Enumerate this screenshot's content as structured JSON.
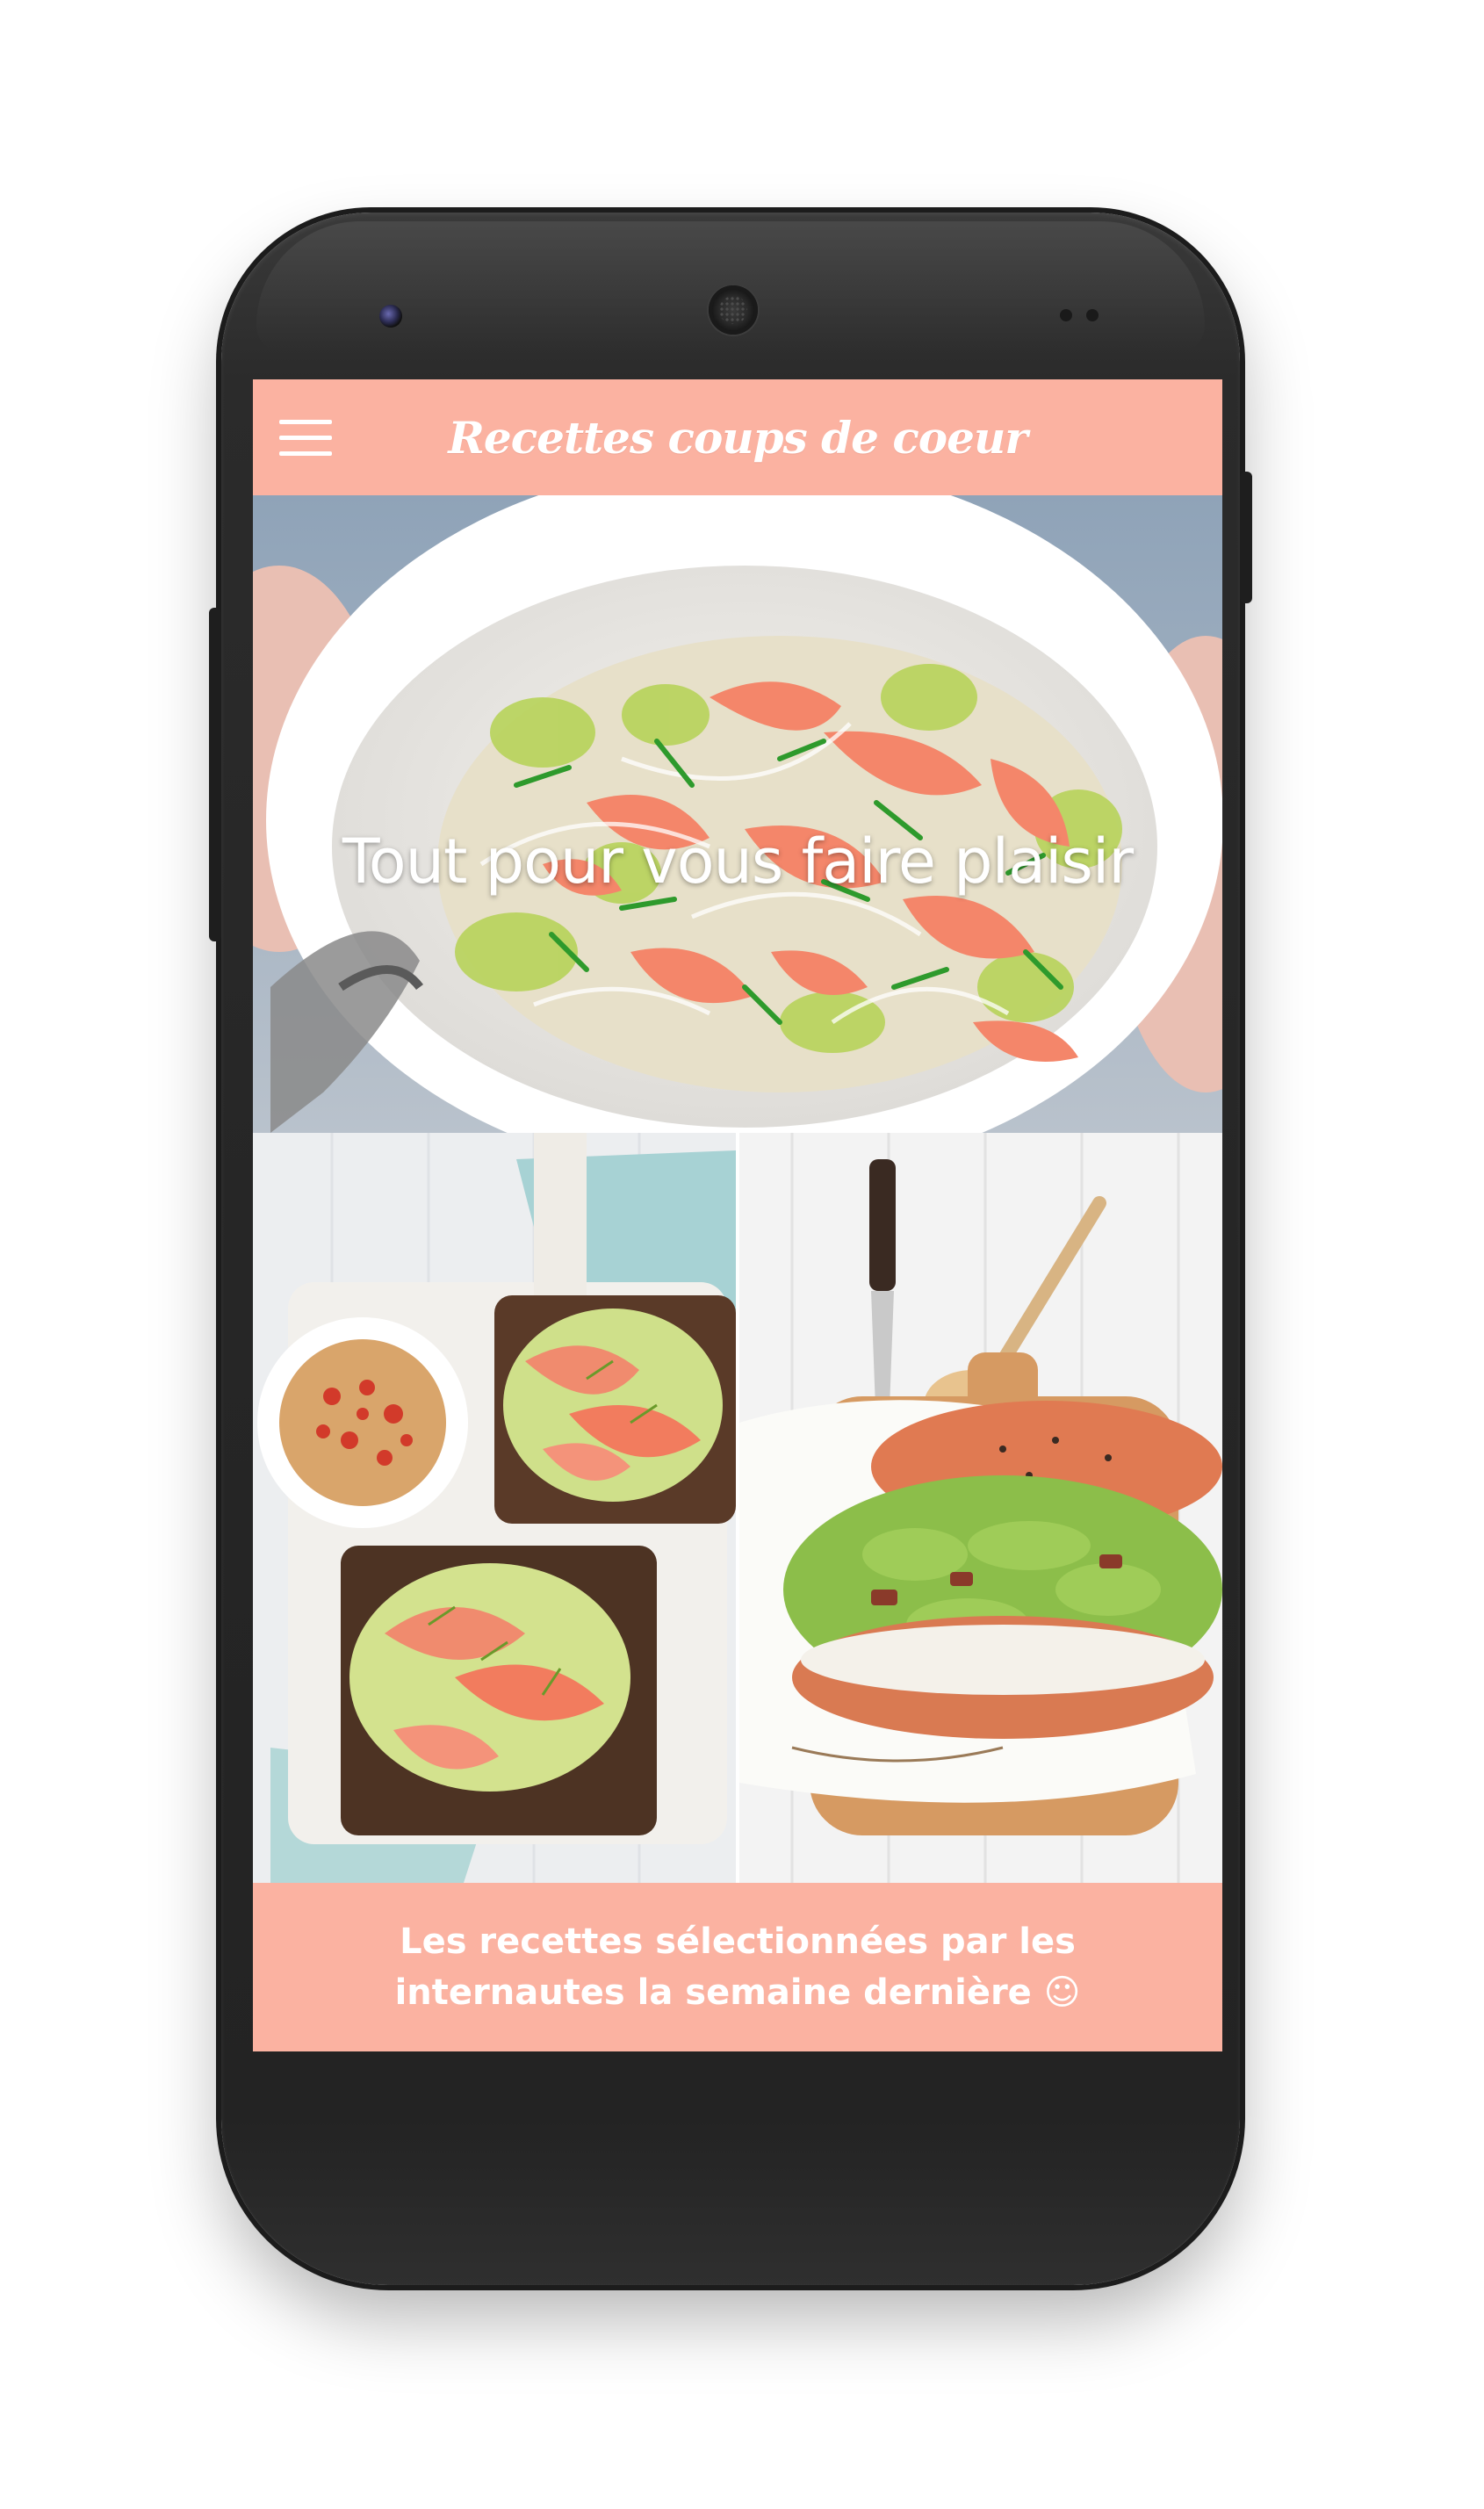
{
  "app_bar": {
    "title": "Recettes coups de coeur",
    "menu_icon": "hamburger-menu-icon"
  },
  "hero": {
    "caption": "Tout pour vous faire plaisir"
  },
  "footer": {
    "text": "Les recettes sélectionnées par les internautes la semaine dernière ☺"
  },
  "colors": {
    "accent": "#fbb2a1",
    "bezel": "#262626",
    "text_on_accent": "#ffffff"
  }
}
